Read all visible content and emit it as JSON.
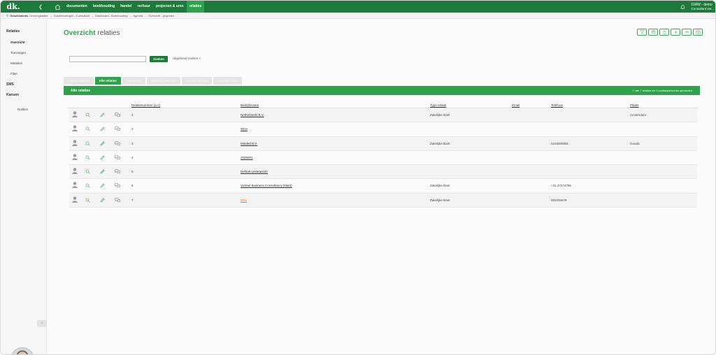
{
  "topbar": {
    "logo": "dk.",
    "nav": [
      "documenten",
      "boekhouding",
      "handel",
      "verhuur",
      "projecten & uren",
      "relaties"
    ],
    "active_index": 5,
    "user_line1": "GWW - demo",
    "user_line2": "Consultant ver..."
  },
  "breadcrumb": {
    "history_label": "Geschiedenis",
    "items": [
      "Urenregistratie",
      "Goedemoringen - Consultant",
      "Dashboard - Boekhouding",
      "Agenda",
      "Overzicht - projecten"
    ]
  },
  "sidebar": {
    "section_relaties": "Relaties",
    "items": [
      "Overzicht",
      "Toevoegen",
      "Mutaties",
      "Filter"
    ],
    "section_sms": "SMS",
    "section_kansen": "Kansen",
    "notities": "Notities"
  },
  "page": {
    "title_bold": "Overzicht",
    "title_rest": "relaties"
  },
  "search": {
    "value": "",
    "placeholder": "",
    "button": "Zoeken",
    "advanced": "Uitgebreid zoeken +"
  },
  "tabs": [
    "Laatste relaties",
    "Alle relaties",
    "Favorieten",
    "Vandaag bekeken",
    "Recent bewerkt",
    "Zakelijke klant"
  ],
  "active_tab": 1,
  "panel": {
    "title": "Alle relaties",
    "count_text": "7 van 7 relaties en 0 contactpersonen gevonden."
  },
  "table": {
    "headers": {
      "relnr": "Relatienummer (a-z)",
      "bedrijf": "Bedrijfsnaam",
      "type": "Type relatie",
      "email": "Email",
      "telefoon": "Telefoon",
      "plaats": "Plaats"
    },
    "rows": [
      {
        "nr": "1",
        "naam": "Netherlands B.V.",
        "type": "Zakelijke klant",
        "email": "",
        "tel": "",
        "plaats": "Amsterdam"
      },
      {
        "nr": "2",
        "naam": "Wise",
        "type": "",
        "email": "",
        "tel": "",
        "plaats": ""
      },
      {
        "nr": "3",
        "naam": "Minded B.V.",
        "type": "Zakelijke klant",
        "email": "",
        "tel": "0103400601",
        "plaats": "Gouda"
      },
      {
        "nr": "4",
        "naam": "2025001",
        "type": "",
        "email": "",
        "tel": "",
        "plaats": ""
      },
      {
        "nr": "5",
        "naam": "Default Leverancier",
        "type": "",
        "email": "",
        "tel": "",
        "plaats": ""
      },
      {
        "nr": "6",
        "naam": "Voskuil Business Consultancy (klant)",
        "type": "Zakelijke klant",
        "email": "",
        "tel": "+31 37274796",
        "plaats": ""
      },
      {
        "nr": "7",
        "naam": "Dibo",
        "type": "Zakelijke klant",
        "email": "",
        "tel": "061235678",
        "plaats": ""
      }
    ]
  },
  "colors": {
    "brand_dark": "#1e7a3a",
    "brand": "#2ea24a",
    "link_orange": "#e07a2a"
  }
}
